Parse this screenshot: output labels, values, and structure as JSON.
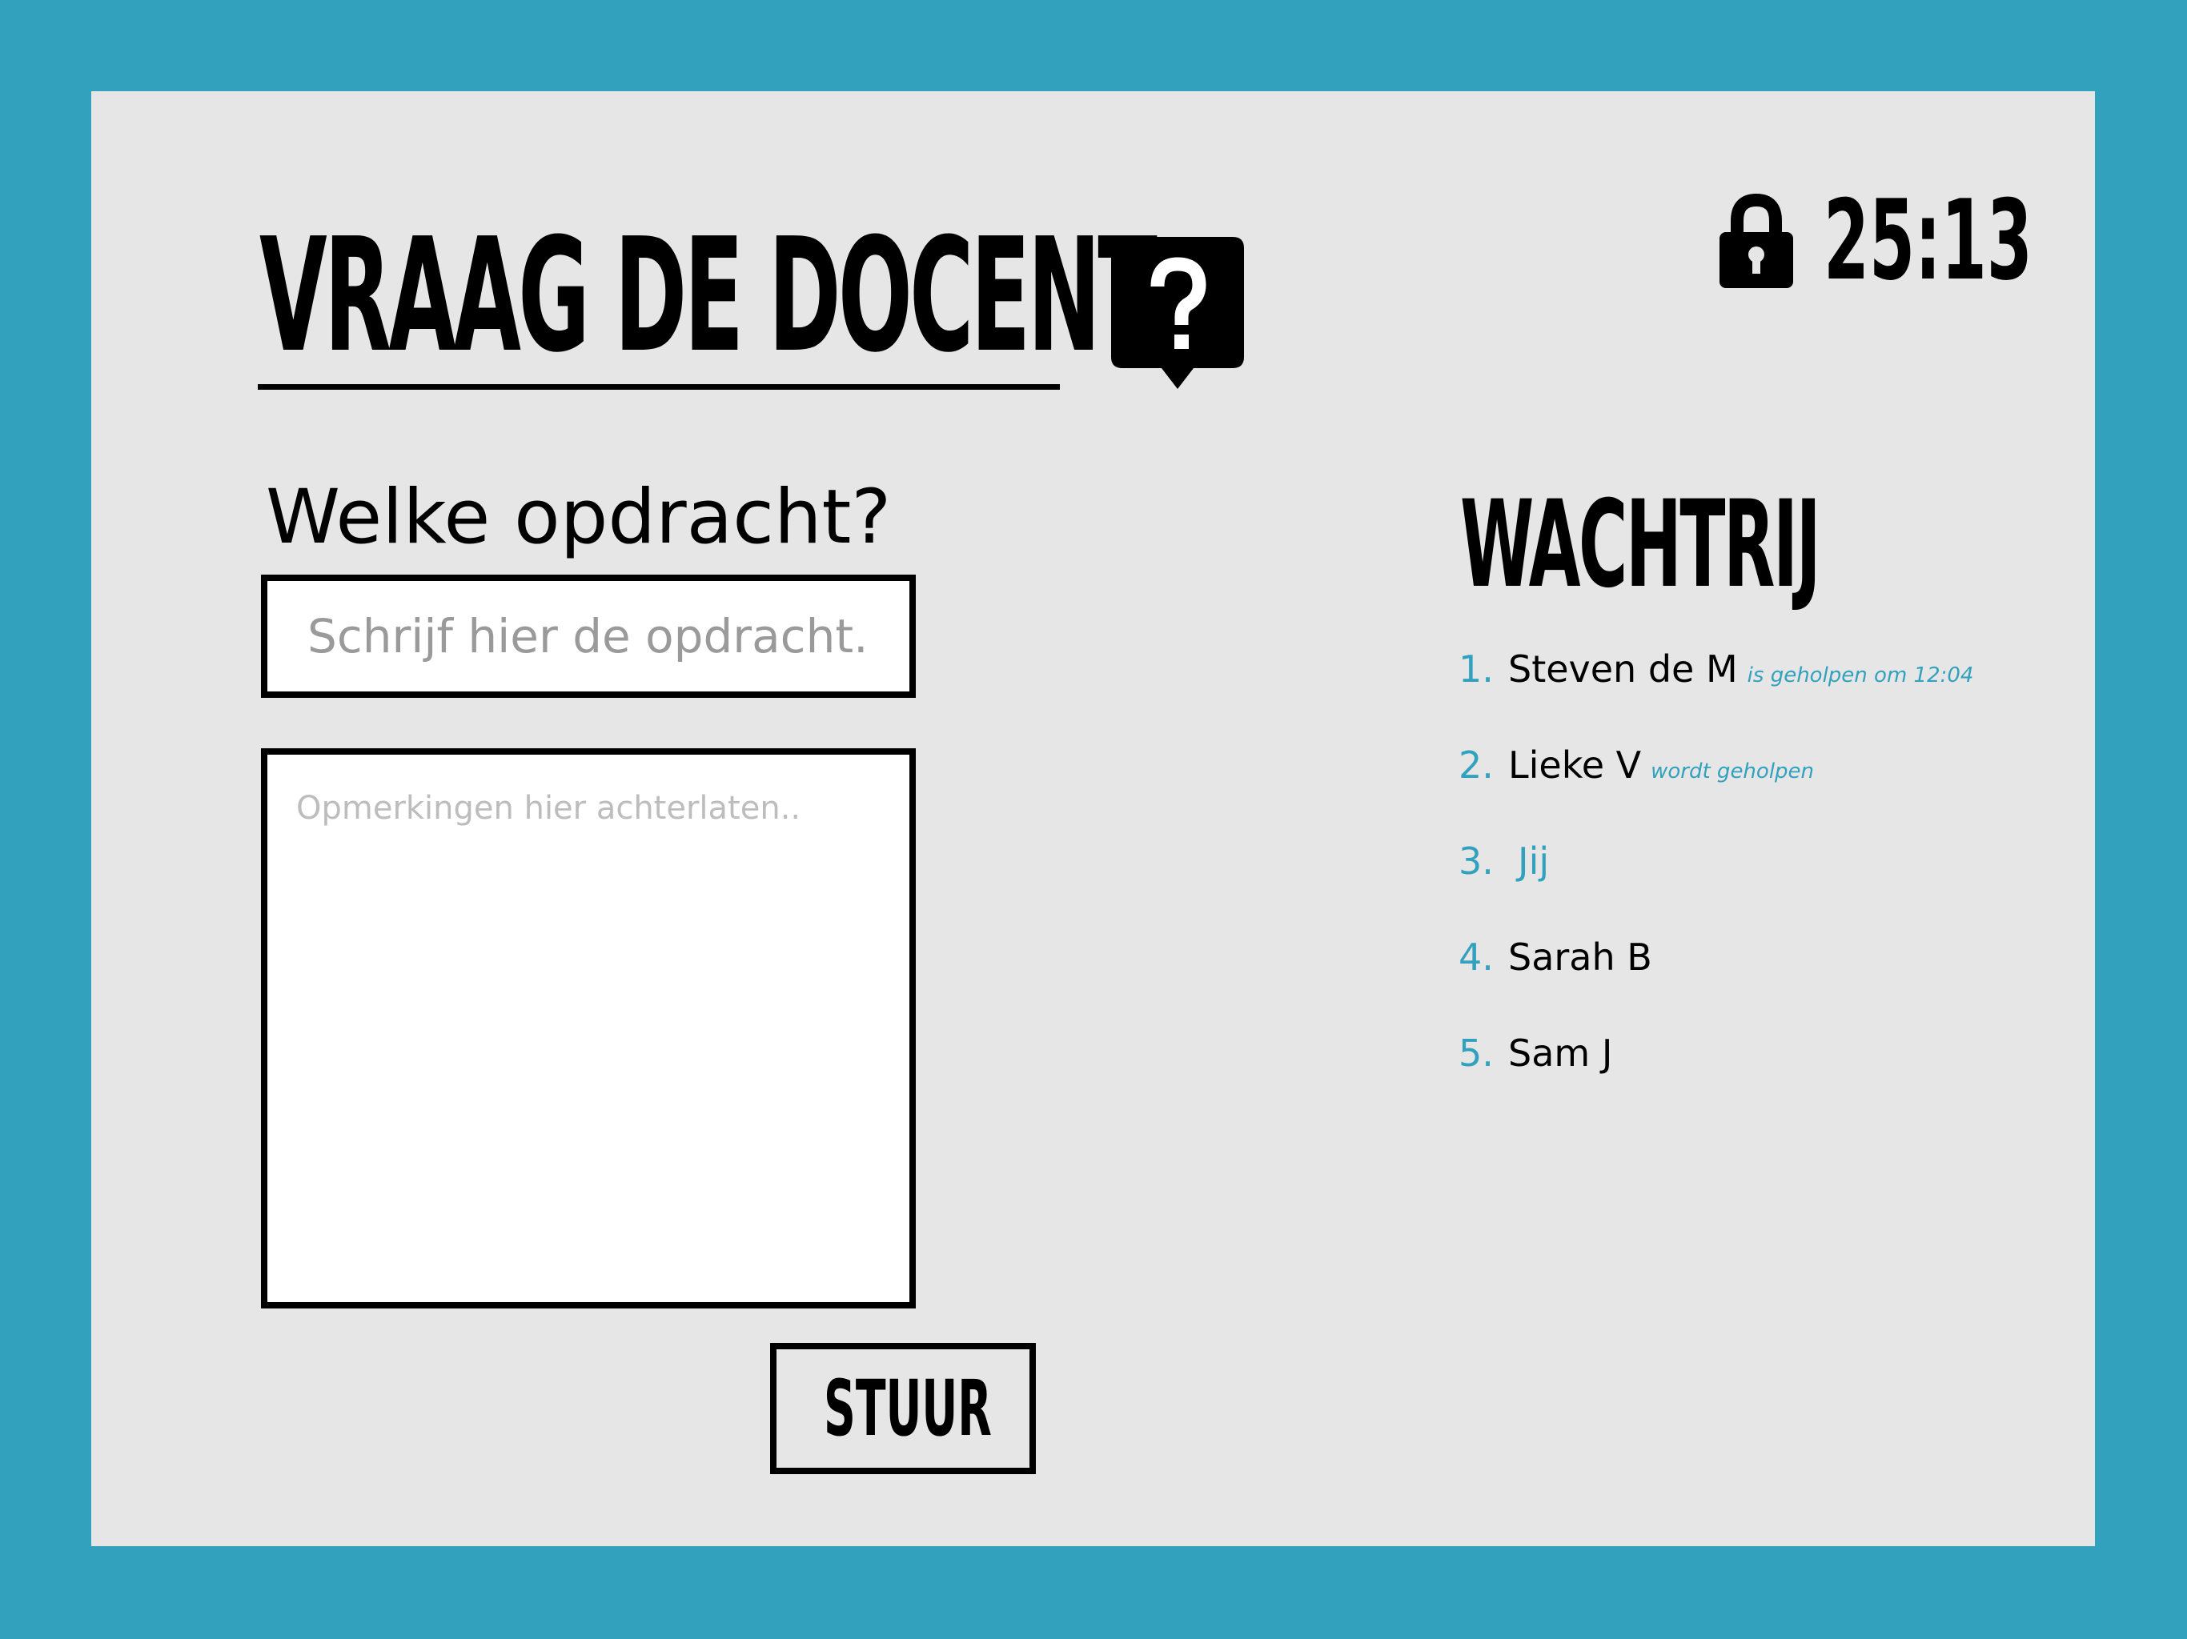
{
  "app": {
    "title": "VRAAG DE DOCENT",
    "timer": "25:13"
  },
  "form": {
    "question_label": "Welke opdracht?",
    "task_placeholder": "Schrijf hier de opdracht..",
    "remarks_placeholder": "Opmerkingen hier achterlaten..",
    "send_label": "STUUR"
  },
  "queue": {
    "title": "WACHTRIJ",
    "items": [
      {
        "number": "1.",
        "name": "Steven de M",
        "status": "is geholpen om 12:04"
      },
      {
        "number": "2.",
        "name": "Lieke V",
        "status": "wordt geholpen"
      },
      {
        "number": "3.",
        "name": "Jij",
        "status": ""
      },
      {
        "number": "4.",
        "name": "Sarah B",
        "status": ""
      },
      {
        "number": "5.",
        "name": "Sam J",
        "status": ""
      }
    ]
  },
  "icons": {
    "help": "question-bubble-icon",
    "lock": "lock-icon"
  },
  "colors": {
    "accent": "#31a1bd",
    "panel": "#e6e6e6",
    "text": "#000000",
    "placeholder": "#9a9a9a"
  }
}
